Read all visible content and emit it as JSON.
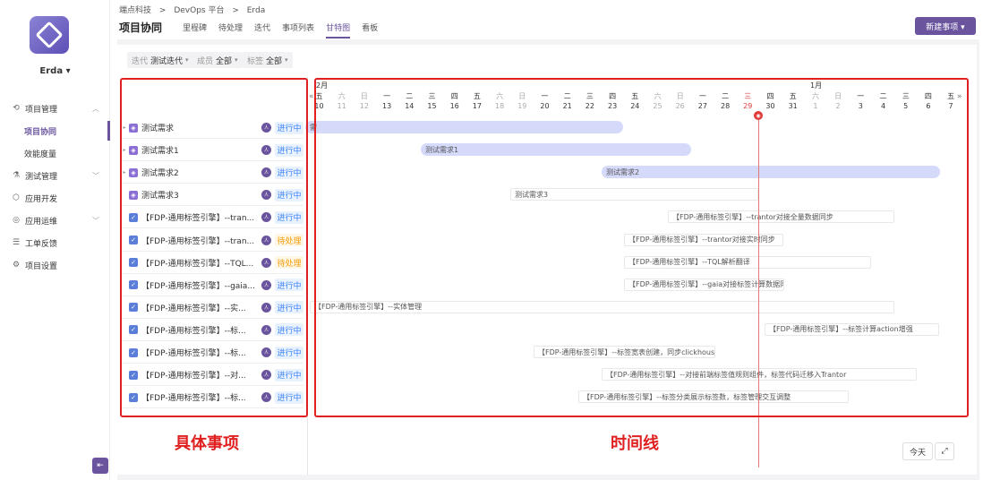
{
  "sidebar": {
    "org": "Erda",
    "menu": [
      {
        "label": "项目管理",
        "icon": "project-icon",
        "expanded": true
      },
      {
        "label": "项目协同",
        "sub": true,
        "active": true
      },
      {
        "label": "效能度量",
        "sub": true
      },
      {
        "label": "测试管理",
        "icon": "test-icon"
      },
      {
        "label": "应用开发",
        "icon": "app-dev-icon"
      },
      {
        "label": "应用运维",
        "icon": "ops-icon"
      },
      {
        "label": "工单反馈",
        "icon": "ticket-icon"
      },
      {
        "label": "项目设置",
        "icon": "settings-icon"
      }
    ]
  },
  "header": {
    "breadcrumb": [
      "端点科技",
      ">",
      "DevOps 平台",
      ">",
      "Erda"
    ],
    "title": "项目协同",
    "tabs": [
      "里程碑",
      "待处理",
      "迭代",
      "事项列表",
      "甘特图",
      "看板"
    ],
    "active_tab": "甘特图",
    "new_button": "新建事项 ▾"
  },
  "filters": [
    {
      "label": "迭代",
      "value": "测试迭代"
    },
    {
      "label": "成员",
      "value": "全部"
    },
    {
      "label": "标签",
      "value": "全部"
    }
  ],
  "timeline": {
    "month_left": "2月",
    "month_right": "1月",
    "nav_prev": "«",
    "nav_next": "»",
    "days": [
      {
        "w": "五",
        "d": "10"
      },
      {
        "w": "六",
        "d": "11",
        "we": true
      },
      {
        "w": "日",
        "d": "12",
        "we": true
      },
      {
        "w": "一",
        "d": "13"
      },
      {
        "w": "二",
        "d": "14"
      },
      {
        "w": "三",
        "d": "15"
      },
      {
        "w": "四",
        "d": "16"
      },
      {
        "w": "五",
        "d": "17"
      },
      {
        "w": "六",
        "d": "18",
        "we": true
      },
      {
        "w": "日",
        "d": "19",
        "we": true
      },
      {
        "w": "一",
        "d": "20"
      },
      {
        "w": "二",
        "d": "21"
      },
      {
        "w": "三",
        "d": "22"
      },
      {
        "w": "四",
        "d": "23"
      },
      {
        "w": "五",
        "d": "24"
      },
      {
        "w": "六",
        "d": "25",
        "we": true
      },
      {
        "w": "日",
        "d": "26",
        "we": true
      },
      {
        "w": "一",
        "d": "27"
      },
      {
        "w": "二",
        "d": "28"
      },
      {
        "w": "三",
        "d": "29",
        "today": true
      },
      {
        "w": "四",
        "d": "30"
      },
      {
        "w": "五",
        "d": "31"
      },
      {
        "w": "六",
        "d": "1",
        "we": true
      },
      {
        "w": "日",
        "d": "2",
        "we": true
      },
      {
        "w": "一",
        "d": "3"
      },
      {
        "w": "二",
        "d": "4"
      },
      {
        "w": "三",
        "d": "5"
      },
      {
        "w": "四",
        "d": "6"
      },
      {
        "w": "五",
        "d": "7"
      }
    ],
    "today_btn": "今天",
    "expand_icon": "expand-icon"
  },
  "rows": [
    {
      "tri": "▸",
      "type": "R",
      "name": "测试需求",
      "status": "进行中",
      "sc": "blue",
      "bar": "需",
      "style": "purple"
    },
    {
      "tri": "▸",
      "type": "R",
      "name": "测试需求1",
      "status": "进行中",
      "sc": "blue",
      "bar": "测试需求1",
      "style": "purple"
    },
    {
      "tri": "▸",
      "type": "R",
      "name": "测试需求2",
      "status": "进行中",
      "sc": "blue",
      "bar": "测试需求2",
      "style": "purple"
    },
    {
      "tri": "",
      "type": "R",
      "name": "测试需求3",
      "status": "进行中",
      "sc": "blue",
      "bar": "测试需求3",
      "style": "white"
    },
    {
      "tri": "",
      "type": "T",
      "name": "【FDP-通用标签引擎】--tran...",
      "status": "进行中",
      "sc": "blue",
      "bar": "【FDP-通用标签引擎】--trantor对接全量数据同步",
      "style": "white"
    },
    {
      "tri": "",
      "type": "T",
      "name": "【FDP-通用标签引擎】--tran...",
      "status": "待处理",
      "sc": "orange",
      "bar": "【FDP-通用标签引擎】--trantor对接实时同步",
      "style": "white"
    },
    {
      "tri": "",
      "type": "T",
      "name": "【FDP-通用标签引擎】--TQL...",
      "status": "待处理",
      "sc": "orange",
      "bar": "【FDP-通用标签引擎】--TQL解析翻译",
      "style": "white"
    },
    {
      "tri": "",
      "type": "T",
      "name": "【FDP-通用标签引擎】--gaia...",
      "status": "进行中",
      "sc": "blue",
      "bar": "【FDP-通用标签引擎】--gaia对接标签计算数据同步",
      "style": "white"
    },
    {
      "tri": "",
      "type": "T",
      "name": "【FDP-通用标签引擎】--实...",
      "status": "进行中",
      "sc": "blue",
      "bar": "【FDP-通用标签引擎】--实体管理",
      "style": "white"
    },
    {
      "tri": "",
      "type": "T",
      "name": "【FDP-通用标签引擎】--标...",
      "status": "进行中",
      "sc": "blue",
      "bar": "【FDP-通用标签引擎】--标签计算action增强",
      "style": "white"
    },
    {
      "tri": "",
      "type": "T",
      "name": "【FDP-通用标签引擎】--标...",
      "status": "进行中",
      "sc": "blue",
      "bar": "【FDP-通用标签引擎】--标签宽表创建，同步clickhouse",
      "style": "white"
    },
    {
      "tri": "",
      "type": "T",
      "name": "【FDP-通用标签引擎】--对...",
      "status": "进行中",
      "sc": "blue",
      "bar": "【FDP-通用标签引擎】--对接前端标签值规则组件，标签代码迁移入Trantor",
      "style": "white"
    },
    {
      "tri": "",
      "type": "T",
      "name": "【FDP-通用标签引擎】--标...",
      "status": "进行中",
      "sc": "blue",
      "bar": "【FDP-通用标签引擎】--标签分类展示标签数，标签管理交互调整",
      "style": "white"
    }
  ],
  "annotations": {
    "left": "具体事项",
    "right": "时间线"
  },
  "colors": {
    "accent": "#6a549e",
    "requirement": "#8b6fd4",
    "task": "#5b7fd8",
    "annotation": "#e02020"
  }
}
